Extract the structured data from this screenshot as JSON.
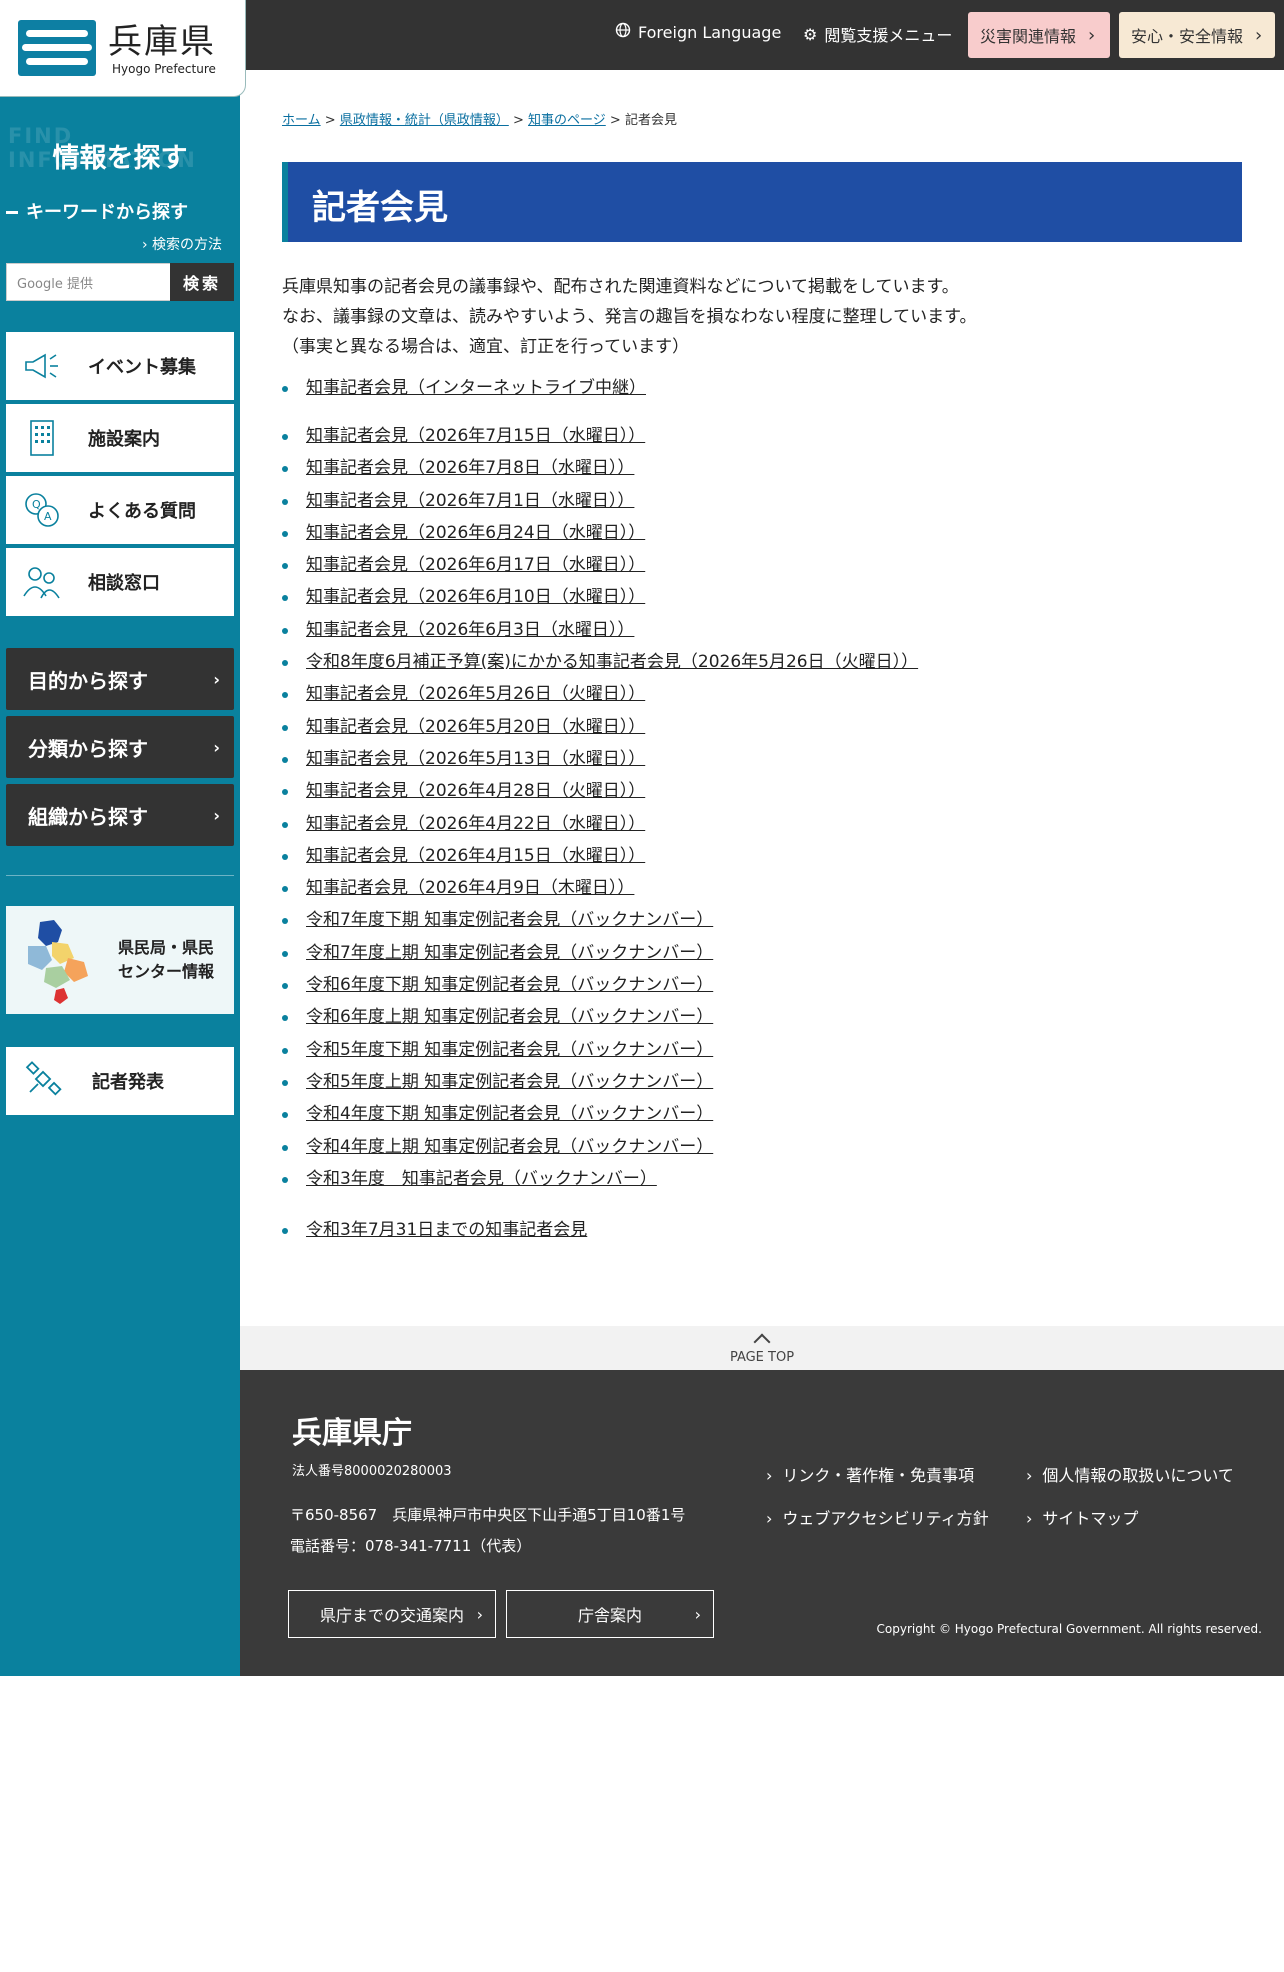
{
  "header": {
    "logo_title": "兵庫県",
    "logo_sub": "Hyogo Prefecture",
    "foreign_language": "Foreign Language",
    "accessibility_menu": "閲覧支援メニュー",
    "disaster_info": "災害関連情報",
    "safety_info": "安心・安全情報",
    "colors": {
      "topbar": "#333333",
      "disaster_bg": "#f8cccc",
      "safety_bg": "#f7e9d4"
    }
  },
  "sidebar": {
    "find_bg_text": "FIND INFORMATION",
    "find_title": "情報を探す",
    "keyword_title": "キーワードから探す",
    "search_howto": "検索の方法",
    "search_placeholder": "Google 提供",
    "search_button": "検索",
    "menu": [
      {
        "label": "イベント募集",
        "icon": "megaphone-icon"
      },
      {
        "label": "施設案内",
        "icon": "building-icon"
      },
      {
        "label": "よくある質問",
        "icon": "qa-icon"
      },
      {
        "label": "相談窓口",
        "icon": "people-icon"
      }
    ],
    "dark_buttons": [
      "目的から探す",
      "分類から探す",
      "組織から探す"
    ],
    "center_card": {
      "line1": "県民局・県民",
      "line2": "センター情報"
    },
    "press_card": "記者発表",
    "colors": {
      "sidebar_bg": "#0a819e"
    }
  },
  "main": {
    "breadcrumb": {
      "home": "ホーム",
      "sep": ">",
      "level2": "県政情報・統計（県政情報）",
      "level3": "知事のページ",
      "current": "記者会見"
    },
    "title": "記者会見",
    "intro": [
      "兵庫県知事の記者会見の議事録や、配布された関連資料などについて掲載をしています。",
      "なお、議事録の文章は、読みやすいよう、発言の趣旨を損なわない程度に整理しています。",
      "（事実と異なる場合は、適宜、訂正を行っています）"
    ],
    "live_link": "知事記者会見（インターネットライブ中継）",
    "links": [
      "知事記者会見（2026年7月15日（水曜日））",
      "知事記者会見（2026年7月8日（水曜日））",
      "知事記者会見（2026年7月1日（水曜日））",
      "知事記者会見（2026年6月24日（水曜日））",
      "知事記者会見（2026年6月17日（水曜日））",
      "知事記者会見（2026年6月10日（水曜日））",
      "知事記者会見（2026年6月3日（水曜日））",
      "令和8年度6月補正予算(案)にかかる知事記者会見（2026年5月26日（火曜日））",
      "知事記者会見（2026年5月26日（火曜日））",
      "知事記者会見（2026年5月20日（水曜日））",
      "知事記者会見（2026年5月13日（水曜日））",
      "知事記者会見（2026年4月28日（火曜日））",
      "知事記者会見（2026年4月22日（水曜日））",
      "知事記者会見（2026年4月15日（水曜日））",
      "知事記者会見（2026年4月9日（木曜日））",
      "令和7年度下期 知事定例記者会見（バックナンバー）",
      "令和7年度上期 知事定例記者会見（バックナンバー）",
      "令和6年度下期 知事定例記者会見（バックナンバー）",
      "令和6年度上期 知事定例記者会見（バックナンバー）",
      "令和5年度下期 知事定例記者会見（バックナンバー）",
      "令和5年度上期 知事定例記者会見（バックナンバー）",
      "令和4年度下期 知事定例記者会見（バックナンバー）",
      "令和4年度上期 知事定例記者会見（バックナンバー）",
      "令和3年度　知事記者会見（バックナンバー）"
    ],
    "old_link": "令和3年7月31日までの知事記者会見",
    "colors": {
      "title_bg": "#1f4ea4",
      "bullet": "#0a819e"
    }
  },
  "footer": {
    "page_top": "PAGE TOP",
    "org_name": "兵庫県庁",
    "corp_number": "法人番号8000020280003",
    "address": "〒650-8567　兵庫県神戸市中央区下山手通5丁目10番1号",
    "phone": "電話番号：078-341-7711（代表）",
    "btn_access": "県庁までの交通案内",
    "btn_building": "庁舎案内",
    "link_terms": "リンク・著作権・免責事項",
    "link_privacy": "個人情報の取扱いについて",
    "link_accessibility": "ウェブアクセシビリティ方針",
    "link_sitemap": "サイトマップ",
    "copyright": "Copyright © Hyogo Prefectural Government. All rights reserved.",
    "colors": {
      "footer_bg": "#3a3a3a"
    }
  }
}
